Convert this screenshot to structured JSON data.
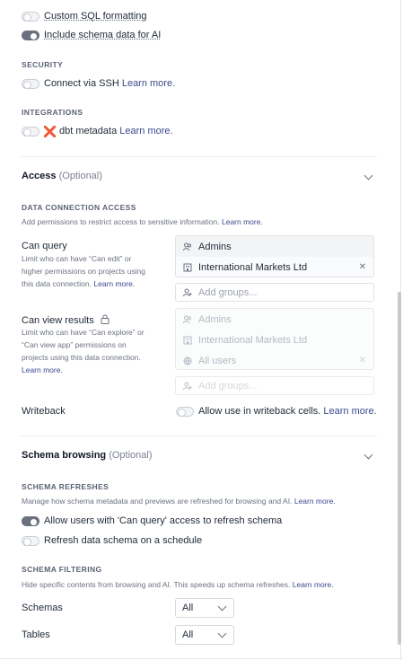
{
  "connection": {
    "custom_sql_label": "Custom SQL formatting",
    "custom_sql_on": false,
    "schema_ai_label": "Include schema data for AI",
    "schema_ai_on": true
  },
  "security": {
    "heading": "SECURITY",
    "ssh_label": "Connect via SSH",
    "ssh_link": "Learn more."
  },
  "integrations": {
    "heading": "INTEGRATIONS",
    "dbt_label": "dbt metadata",
    "dbt_link": "Learn more.",
    "dbt_icon": "dbt-logo-icon"
  },
  "access": {
    "title": "Access",
    "optional": "(Optional)",
    "data_conn_heading": "DATA CONNECTION ACCESS",
    "data_conn_help": "Add permissions to restrict access to sensitive information.",
    "data_conn_link": "Learn more.",
    "can_query": {
      "label": "Can query",
      "help_1": "Limit who can have “Can edit” or",
      "help_2": "higher permissions on projects using",
      "help_3": "this data connection.",
      "link": "Learn more.",
      "groups": [
        "Admins",
        "International Markets Ltd"
      ],
      "add_placeholder": "Add groups..."
    },
    "can_view": {
      "label": "Can view results",
      "help_1": "Limit who can have “Can explore” or",
      "help_2": "“Can view app” permissions on",
      "help_3": "projects using this data connection.",
      "link": "Learn more.",
      "groups": [
        "Admins",
        "International Markets Ltd",
        "All users"
      ],
      "add_placeholder": "Add groups..."
    },
    "writeback": {
      "label": "Writeback",
      "toggle_label": "Allow use in writeback cells.",
      "link": "Learn more."
    }
  },
  "schema": {
    "title": "Schema browsing",
    "optional": "(Optional)",
    "refresh_heading": "SCHEMA REFRESHES",
    "refresh_help": "Manage how schema metadata and previews are refreshed for browsing and AI.",
    "refresh_link": "Learn more.",
    "allow_refresh_label": "Allow users with 'Can query' access to refresh schema",
    "allow_refresh_on": true,
    "schedule_label": "Refresh data schema on a schedule",
    "schedule_on": false,
    "filter_heading": "SCHEMA FILTERING",
    "filter_help": "Hide specific contents from browsing and AI. This speeds up schema refreshes.",
    "filter_link": "Learn more.",
    "schemas_label": "Schemas",
    "schemas_value": "All",
    "tables_label": "Tables",
    "tables_value": "All"
  }
}
